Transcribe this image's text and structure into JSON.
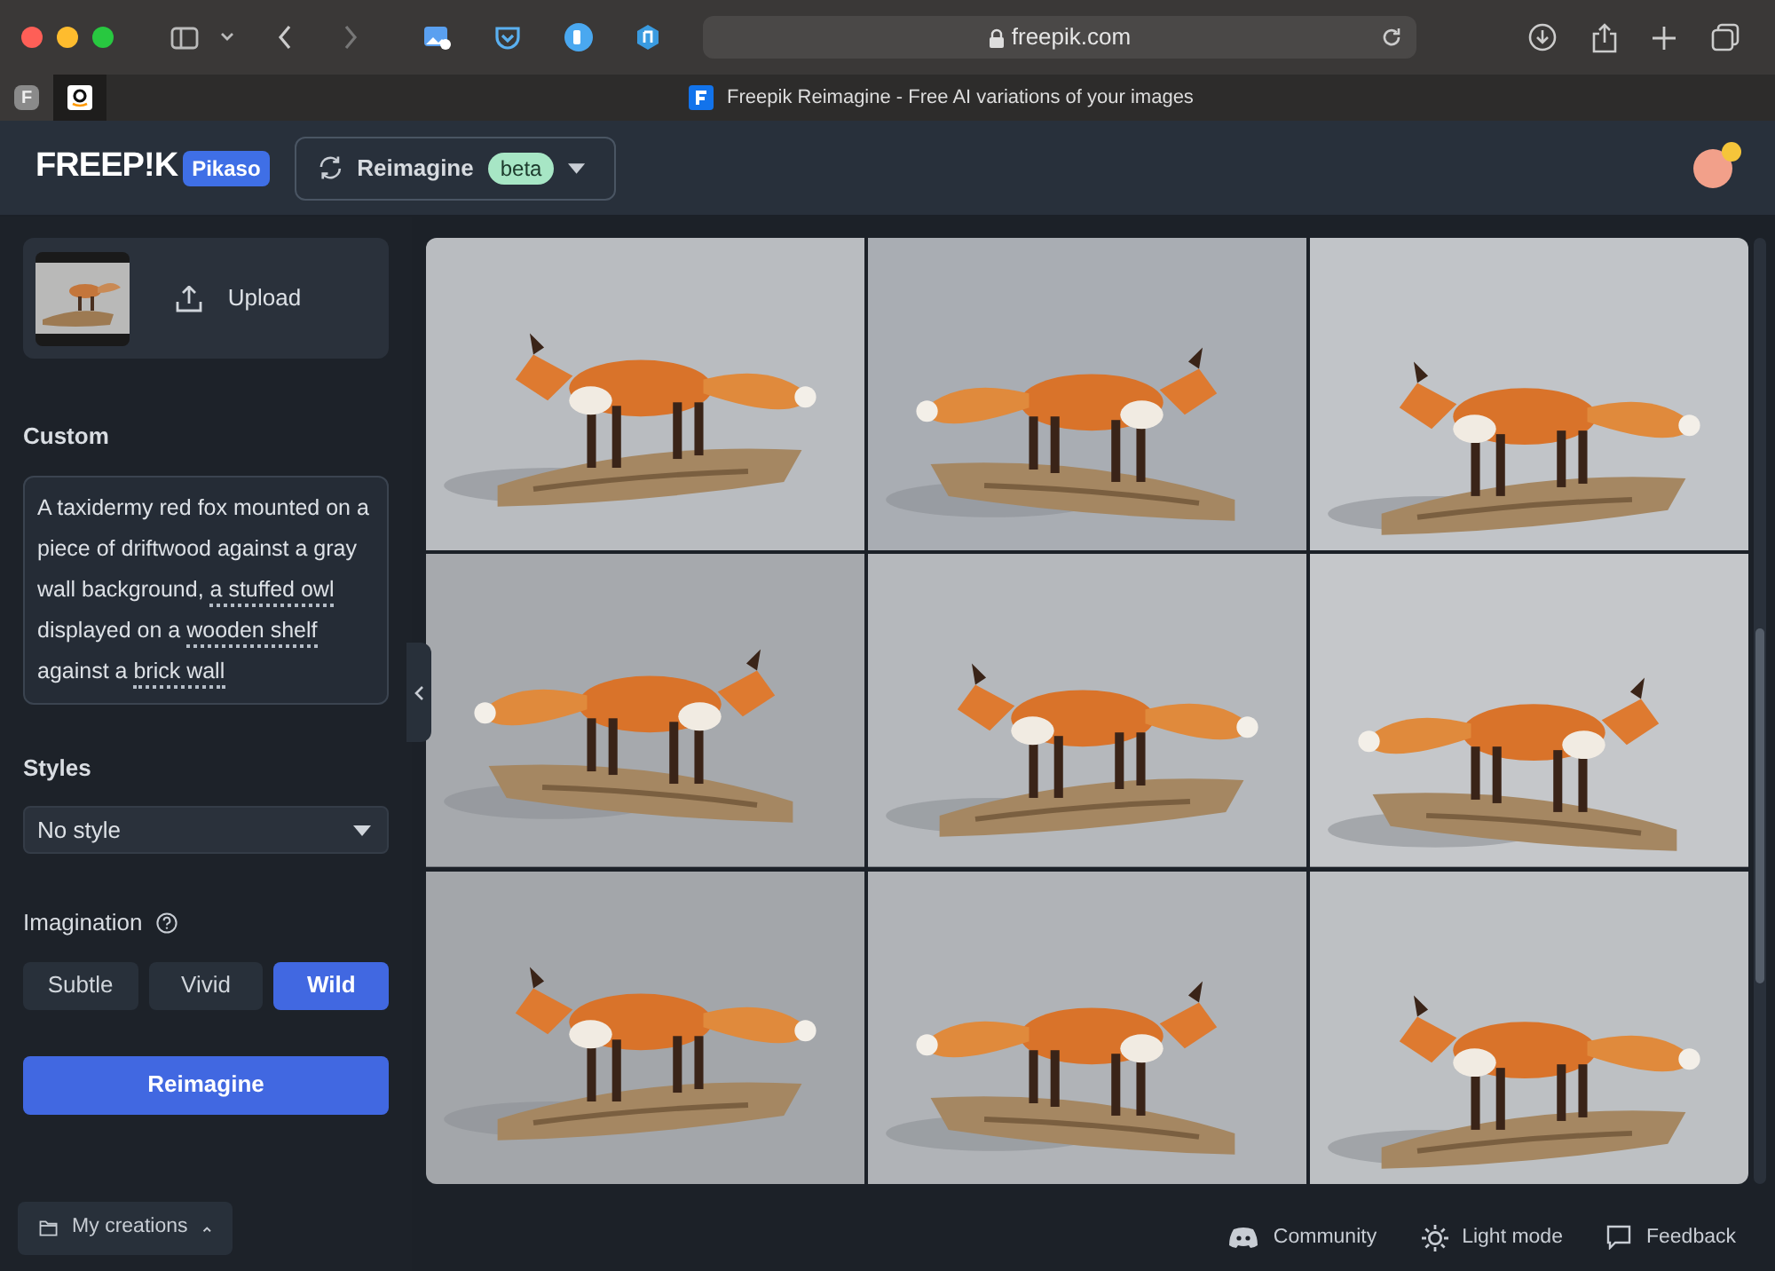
{
  "browser": {
    "address": "freepik.com",
    "tabs": [
      {
        "kind": "letter",
        "label": "F",
        "selected": false
      },
      {
        "kind": "amazon",
        "selected": true
      }
    ],
    "page_title": "Freepik Reimagine - Free AI variations of your images"
  },
  "header": {
    "logo": "FREEP!K",
    "logo_badge": "Pikaso",
    "tool": "Reimagine",
    "tool_badge": "beta"
  },
  "sidebar": {
    "upload": "Upload",
    "custom_label": "Custom",
    "prompt": [
      {
        "text": "A taxidermy red fox mounted on a piece of driftwood against a gray wall background, ",
        "highlighted": false
      },
      {
        "text": "a stuffed owl",
        "highlighted": true
      },
      {
        "text": " displayed on a ",
        "highlighted": false
      },
      {
        "text": "wooden shelf",
        "highlighted": true
      },
      {
        "text": " against a ",
        "highlighted": false
      },
      {
        "text": "brick wall",
        "highlighted": true
      }
    ],
    "styles_label": "Styles",
    "style": "No style",
    "imagination_label": "Imagination",
    "imagination": [
      {
        "label": "Subtle",
        "selected": false
      },
      {
        "label": "Vivid",
        "selected": false
      },
      {
        "label": "Wild",
        "selected": true
      }
    ],
    "action": "Reimagine",
    "creations": "My creations"
  },
  "footer": [
    {
      "kind": "discord",
      "label": "Community"
    },
    {
      "kind": "sun",
      "label": "Light mode"
    },
    {
      "kind": "chat",
      "label": "Feedback"
    }
  ]
}
